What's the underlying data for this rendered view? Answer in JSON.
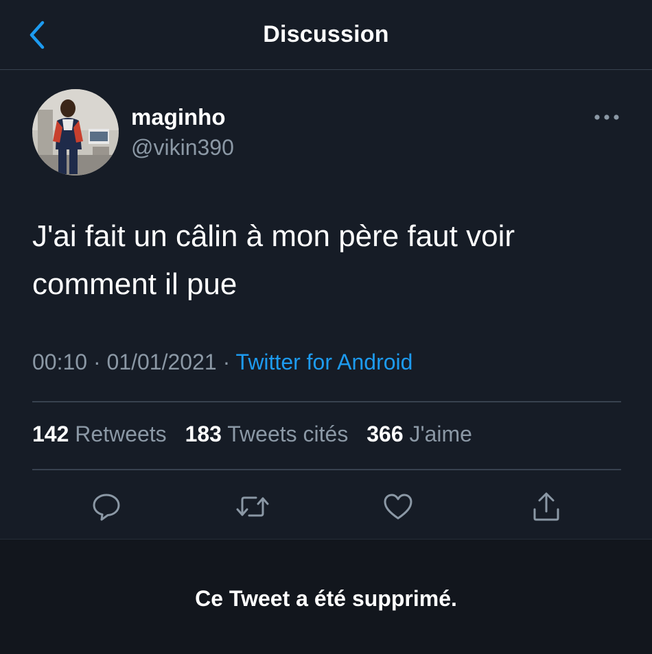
{
  "header": {
    "title": "Discussion",
    "back_icon": "chevron-left-icon",
    "accent_color": "#1d9bf0"
  },
  "tweet": {
    "author": {
      "display_name": "maginho",
      "handle": "@vikin390"
    },
    "text": "J'ai fait un câlin à mon père faut voir comment il pue",
    "time": "00:10",
    "date": "01/01/2021",
    "separator": "·",
    "source": "Twitter for Android",
    "stats": {
      "retweets_count": "142",
      "retweets_label": "Retweets",
      "quotes_count": "183",
      "quotes_label": "Tweets cités",
      "likes_count": "366",
      "likes_label": "J'aime"
    },
    "actions": [
      "reply-icon",
      "retweet-icon",
      "like-icon",
      "share-icon"
    ]
  },
  "notice": {
    "deleted_text": "Ce Tweet a été supprimé."
  }
}
